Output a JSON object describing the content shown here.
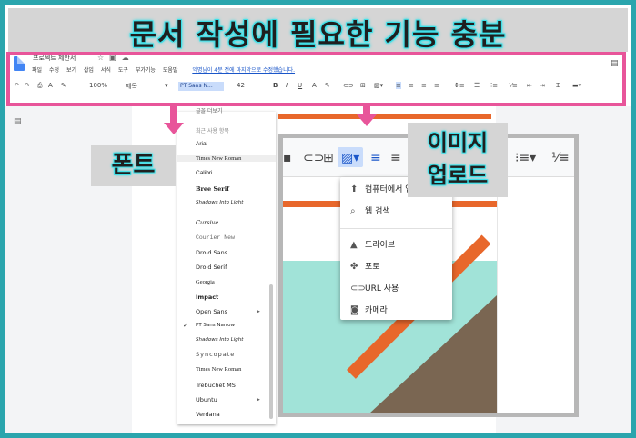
{
  "banner": {
    "title": "문서 작성에 필요한 기능 충분"
  },
  "docs": {
    "title": "프로젝트 제안서",
    "menu": [
      "파일",
      "수정",
      "보기",
      "삽입",
      "서식",
      "도구",
      "부가기능",
      "도움말"
    ],
    "edit_note": "익명님이 4분 전에 마지막으로 수정했습니다.",
    "toolbar": {
      "zoom": "100%",
      "style": "제목",
      "font": "PT Sans N...",
      "size": "42"
    }
  },
  "font_menu": {
    "recent_header": "최근 사용 항목",
    "items": [
      "Arial",
      "Times New Roman",
      "Calibri",
      "Bree Serif",
      "Shadows Into Light",
      "Cursive",
      "Courier New",
      "Droid Sans",
      "Droid Serif",
      "Georgia",
      "Impact",
      "Open Sans",
      "PT Sans Narrow",
      "Shadows Into Light",
      "Syncopate",
      "Times New Roman",
      "Trebuchet MS",
      "Ubuntu",
      "Verdana"
    ],
    "selected": "PT Sans Narrow"
  },
  "labels": {
    "font": "폰트",
    "image_upload_line1": "이미지",
    "image_upload_line2": "업로드"
  },
  "insert_image_menu": {
    "items": [
      {
        "icon": "upload-icon",
        "label": "컴퓨터에서 업로드"
      },
      {
        "icon": "search-icon",
        "label": "웹 검색"
      },
      {
        "icon": "drive-icon",
        "label": "드라이브"
      },
      {
        "icon": "photos-icon",
        "label": "포토"
      },
      {
        "icon": "link-icon",
        "label": "URL 사용"
      },
      {
        "icon": "camera-icon",
        "label": "카메라"
      }
    ]
  },
  "colors": {
    "frame": "#2aa5ad",
    "highlight": "#e8559a",
    "glow": "#3fe0e8",
    "teal": "#a1e3d8",
    "orange": "#e8672b",
    "brown": "#7a6652"
  }
}
